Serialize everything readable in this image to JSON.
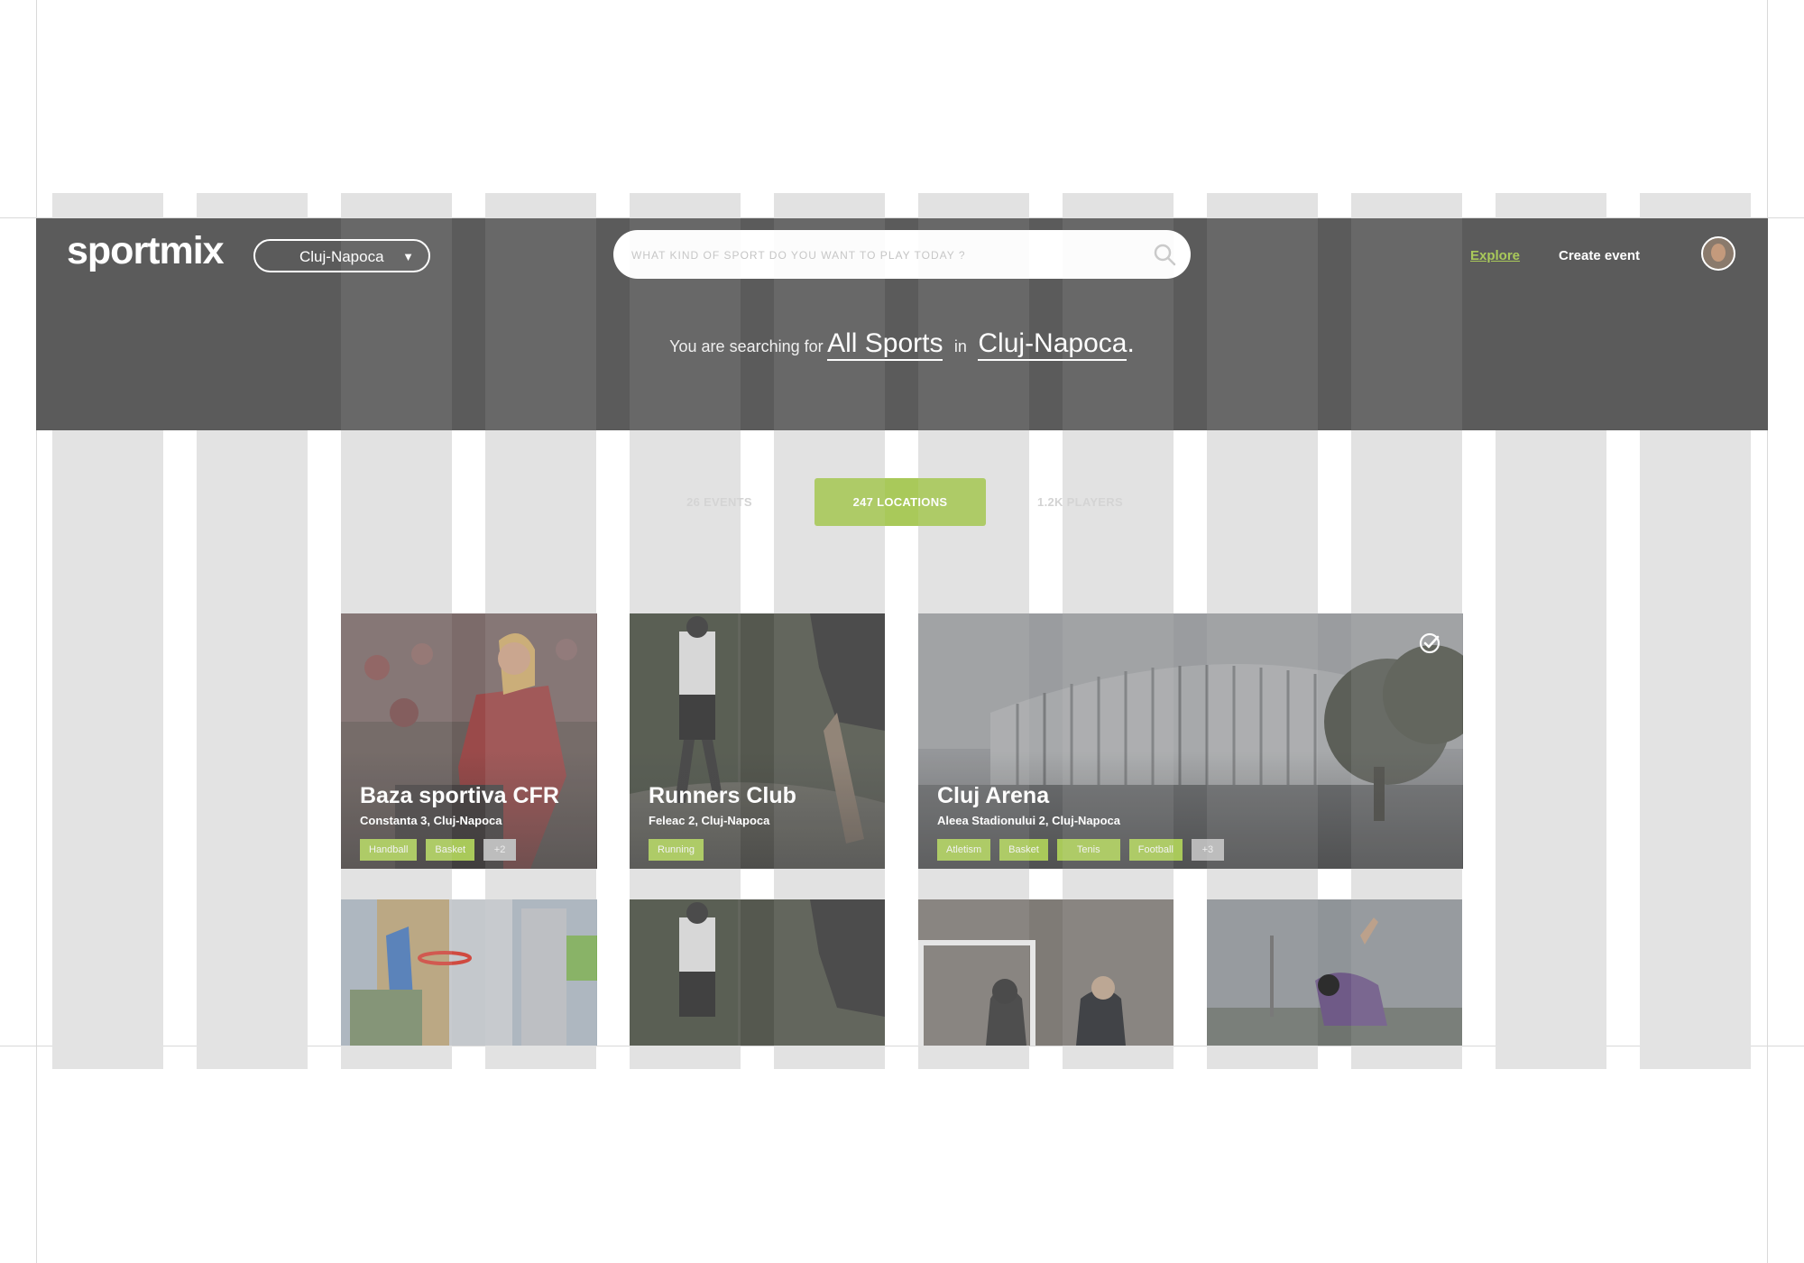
{
  "brand": {
    "logo_text": "sportmix"
  },
  "header": {
    "city_selector": {
      "value": "Cluj-Napoca",
      "caret": "▼"
    },
    "search": {
      "placeholder": "WHAT KIND OF SPORT DO YOU WANT TO PLAY TODAY ?"
    },
    "nav": {
      "explore": "Explore",
      "create_event": "Create event"
    },
    "summary": {
      "prefix": "You are searching for",
      "sport": "All Sports",
      "connector": "in",
      "location": "Cluj-Napoca",
      "suffix": "."
    }
  },
  "tabs": [
    {
      "label": "26 EVENTS",
      "active": false
    },
    {
      "label": "247 LOCATIONS",
      "active": true
    },
    {
      "label": "1.2K PLAYERS",
      "active": false
    }
  ],
  "cards": [
    {
      "title": "Baza sportiva CFR",
      "address": "Constanta 3, Cluj-Napoca",
      "tags": [
        "Handball",
        "Basket"
      ],
      "more": "+2",
      "photo": "handball-player"
    },
    {
      "title": "Runners Club",
      "address": "Feleac 2, Cluj-Napoca",
      "tags": [
        "Running"
      ],
      "more": "",
      "photo": "trail-runner"
    },
    {
      "title": "Cluj Arena",
      "address": "Aleea Stadionului 2, Cluj-Napoca",
      "tags": [
        "Atletism",
        "Basket",
        "Tenis",
        "Football"
      ],
      "more": "+3",
      "photo": "stadium",
      "selected": true
    }
  ],
  "bottom_cards": [
    "basketball-hoop",
    "trail-runner",
    "futsal-players",
    "skateboarder"
  ],
  "colors": {
    "accent": "#a9c95a",
    "header_bg": "#5b5b5b",
    "grid_overlay": "#e3e3e3",
    "tag_more": "#b9b9b9"
  },
  "icons": [
    "search-icon",
    "chevron-down-icon",
    "avatar",
    "check-circle-icon"
  ]
}
